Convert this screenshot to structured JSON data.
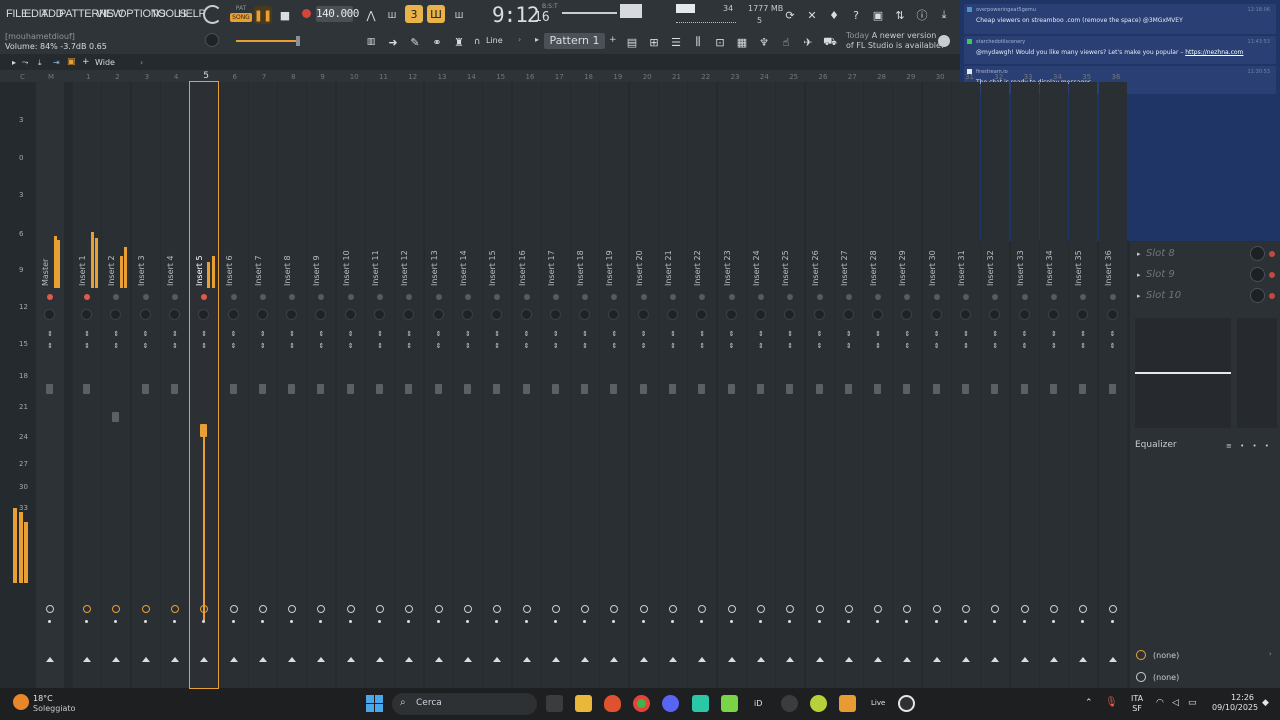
{
  "menu": [
    "FILE",
    "EDIT",
    "ADD",
    "PATTERNS",
    "VIEW",
    "OPTIONS",
    "TOOLS",
    "HELP"
  ],
  "transport": {
    "pat_label": "PAT",
    "song_label": "SONG",
    "tempo": "140.000"
  },
  "clock": {
    "time": "9:12",
    "seconds": "16",
    "unit": "B:S:T"
  },
  "monitor": {
    "cpu": "34",
    "memory": "1777 MB",
    "polyphony": "5"
  },
  "hint": {
    "user": "[mouhametdiouf]",
    "volume": "Volume: 84%  -3.7dB  0.65"
  },
  "toolbar2": {
    "snap": "Line",
    "pattern": "Pattern 1"
  },
  "news": {
    "today": "Today",
    "message": "A newer version of FL Studio is available!"
  },
  "mixer": {
    "view_label": "Wide",
    "ruler": [
      "C",
      "M",
      "1",
      "2",
      "3",
      "4",
      "5",
      "6",
      "7",
      "8",
      "9",
      "10",
      "11",
      "12",
      "13",
      "14",
      "15",
      "16",
      "17",
      "18",
      "19",
      "20",
      "21",
      "22",
      "23",
      "24",
      "25",
      "26",
      "27",
      "28",
      "29",
      "30",
      "31",
      "32",
      "33",
      "34",
      "35",
      "36"
    ],
    "db_scale": [
      "3",
      "0",
      "3",
      "6",
      "9",
      "12",
      "15",
      "18",
      "21",
      "24",
      "27",
      "30",
      "33"
    ],
    "channels": [
      "Master",
      "Insert 1",
      "Insert 2",
      "Insert 3",
      "Insert 4",
      "Insert 5",
      "Insert 6",
      "Insert 7",
      "Insert 8",
      "Insert 9",
      "Insert 10",
      "Insert 11",
      "Insert 12",
      "Insert 13",
      "Insert 14",
      "Insert 15",
      "Insert 16",
      "Insert 17",
      "Insert 18",
      "Insert 19",
      "Insert 20",
      "Insert 21",
      "Insert 22",
      "Insert 23",
      "Insert 24",
      "Insert 25",
      "Insert 26",
      "Insert 27",
      "Insert 28",
      "Insert 29",
      "Insert 30",
      "Insert 31",
      "Insert 32",
      "Insert 33",
      "Insert 34",
      "Insert 35",
      "Insert 36"
    ],
    "selected": "Insert 5"
  },
  "fx_panel": {
    "slots": [
      "Slot 8",
      "Slot 9",
      "Slot 10"
    ],
    "eq_label": "Equalizer",
    "sends": [
      "(none)",
      "(none)"
    ]
  },
  "chat": [
    {
      "user": "overpoweringeat5gemu",
      "time": "12:18:06",
      "text": "Cheap viewers on streamboo .com (remove the space) @3MGxMVEY",
      "link": ""
    },
    {
      "user": "starchedotilscenery",
      "time": "11:43:53",
      "text": "@mydawgh! Would you like many viewers? Let's make you popular – ",
      "link": "https://nezhna.com"
    },
    {
      "user": "firestream.io",
      "time": "11:30:53",
      "text": "The chat is ready to display messages.",
      "link": ""
    }
  ],
  "taskbar": {
    "weather_temp": "18°C",
    "weather_desc": "Soleggiato",
    "search": "Cerca",
    "lang_1": "ITA",
    "lang_2": "SF",
    "time": "12:26",
    "date": "09/10/2025",
    "app_live": "Live",
    "app_id": "iD"
  },
  "colors": {
    "accent": "#e8a035",
    "chat_bg": "#1f3566",
    "mixer_bg": "#252a2e"
  }
}
